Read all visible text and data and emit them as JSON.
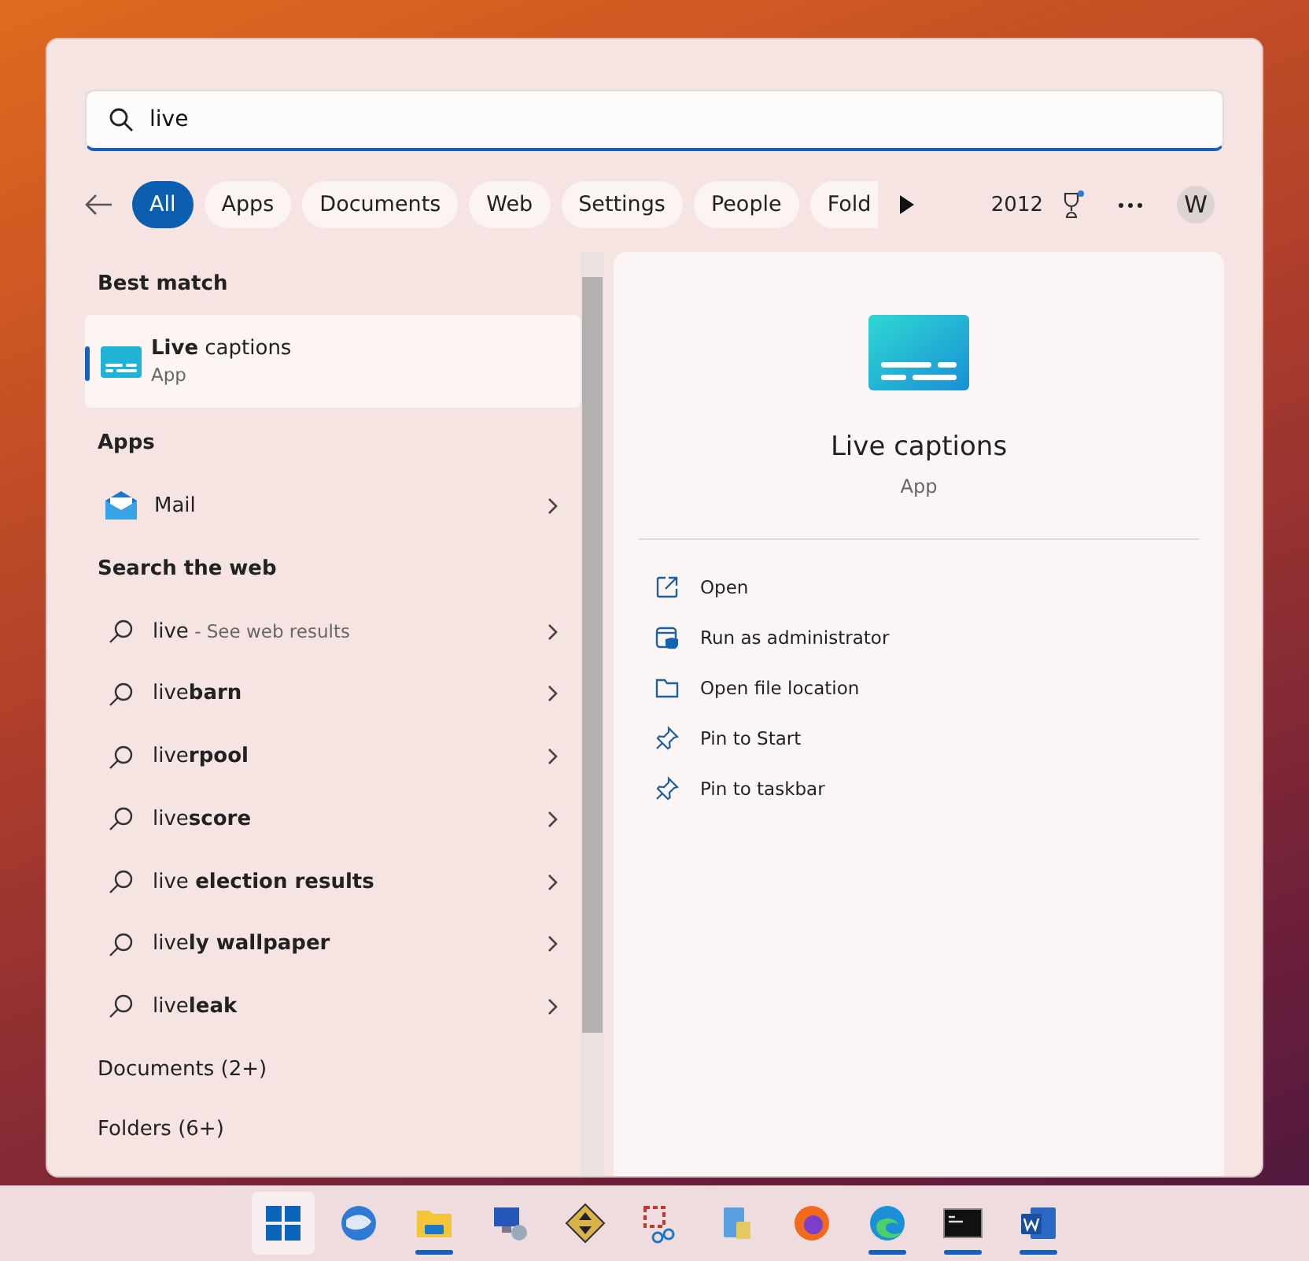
{
  "search": {
    "value": "live"
  },
  "filters": [
    {
      "label": "All",
      "selected": true
    },
    {
      "label": "Apps",
      "selected": false
    },
    {
      "label": "Documents",
      "selected": false
    },
    {
      "label": "Web",
      "selected": false
    },
    {
      "label": "Settings",
      "selected": false
    },
    {
      "label": "People",
      "selected": false
    },
    {
      "label": "Fold",
      "selected": false
    }
  ],
  "points": "2012",
  "account_initial": "W",
  "best_match": {
    "heading": "Best match",
    "title": "**Live** captions",
    "subtitle": "App",
    "selected": true
  },
  "apps": {
    "heading": "Apps",
    "items": [
      {
        "label": "Mail"
      }
    ]
  },
  "web": {
    "heading": "Search the web",
    "items": [
      {
        "label": "live",
        "note": "- See web results"
      },
      {
        "label": "live**barn**"
      },
      {
        "label": "live**rpool**"
      },
      {
        "label": "live**score**"
      },
      {
        "label": "live **election results**"
      },
      {
        "label": "live**ly wallpaper**"
      },
      {
        "label": "live**leak**"
      }
    ]
  },
  "more_sections": [
    "Documents (2+)",
    "Folders (6+)"
  ],
  "detail": {
    "title": "Live captions",
    "subtitle": "App",
    "actions": [
      {
        "kind": "open",
        "label": "Open"
      },
      {
        "kind": "admin",
        "label": "Run as administrator"
      },
      {
        "kind": "folder",
        "label": "Open file location"
      },
      {
        "kind": "pin",
        "label": "Pin to Start"
      },
      {
        "kind": "pin",
        "label": "Pin to taskbar"
      }
    ]
  },
  "taskbar": [
    {
      "kind": "start",
      "selected": true,
      "running": false
    },
    {
      "kind": "mail",
      "selected": false,
      "running": false
    },
    {
      "kind": "folder",
      "selected": false,
      "running": true
    },
    {
      "kind": "remote",
      "selected": false,
      "running": false
    },
    {
      "kind": "arrows",
      "selected": false,
      "running": false
    },
    {
      "kind": "snip",
      "selected": false,
      "running": false
    },
    {
      "kind": "calc",
      "selected": false,
      "running": false
    },
    {
      "kind": "firefox",
      "selected": false,
      "running": false
    },
    {
      "kind": "edge",
      "selected": false,
      "running": true
    },
    {
      "kind": "terminal",
      "selected": false,
      "running": true
    },
    {
      "kind": "word",
      "selected": false,
      "running": true
    }
  ]
}
